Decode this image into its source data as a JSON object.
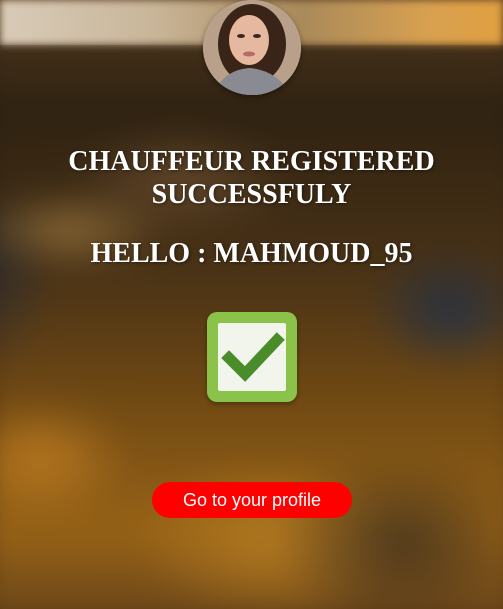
{
  "header": {
    "avatar_icon": "user-avatar-photo"
  },
  "main": {
    "title": "CHAUFFEUR REGISTERED SUCCESSFULY",
    "greeting": "HELLO : MAHMOUD_95",
    "status_icon": "check-mark-icon"
  },
  "actions": {
    "profile_button_label": "Go to your profile"
  },
  "colors": {
    "button_background": "#ff0000",
    "check_box_green": "#8bc34a",
    "check_mark_green": "#4a8c2a",
    "text": "#ffffff"
  }
}
